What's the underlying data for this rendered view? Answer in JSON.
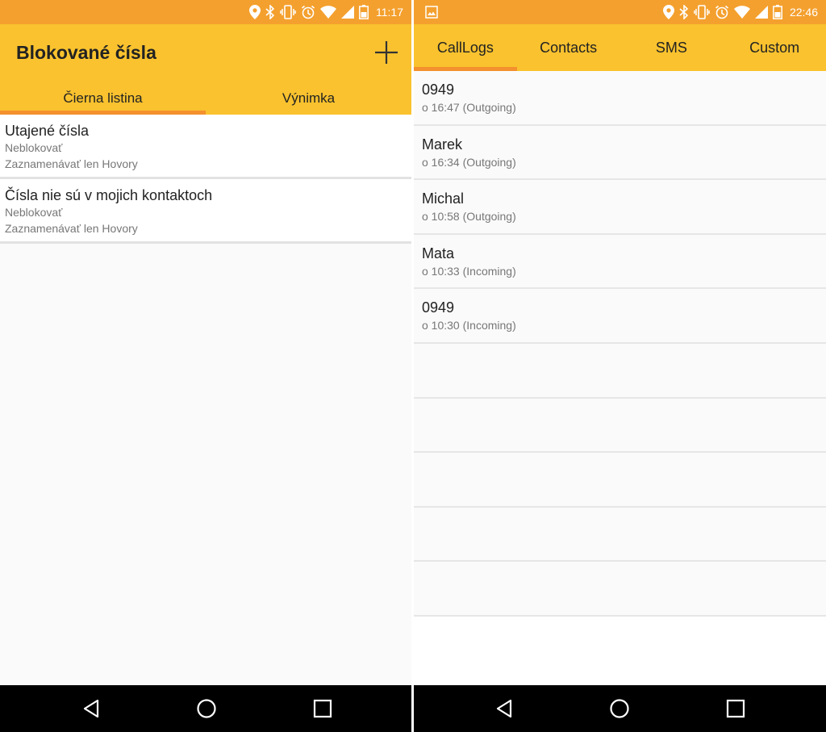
{
  "left": {
    "status": {
      "time": "11:17"
    },
    "appbar": {
      "title": "Blokované čísla"
    },
    "tabs": [
      {
        "label": "Čierna listina",
        "active": true
      },
      {
        "label": "Výnimka",
        "active": false
      }
    ],
    "items": [
      {
        "title": "Utajené čísla",
        "line1": "Neblokovať",
        "line2": "Zaznamenávať len Hovory"
      },
      {
        "title": "Čísla nie sú v mojich kontaktoch",
        "line1": "Neblokovať",
        "line2": "Zaznamenávať len Hovory"
      }
    ]
  },
  "right": {
    "status": {
      "time": "22:46"
    },
    "tabs": [
      {
        "label": "CallLogs",
        "active": true
      },
      {
        "label": "Contacts",
        "active": false
      },
      {
        "label": "SMS",
        "active": false
      },
      {
        "label": "Custom",
        "active": false
      }
    ],
    "calls": [
      {
        "name": "0949",
        "detail": "o 16:47 (Outgoing)"
      },
      {
        "name": "Marek",
        "detail": "o 16:34 (Outgoing)"
      },
      {
        "name": "Michal",
        "detail": "o 10:58 (Outgoing)"
      },
      {
        "name": "Mata",
        "detail": "o 10:33 (Incoming)"
      },
      {
        "name": "0949",
        "detail": "o 10:30 (Incoming)"
      }
    ]
  },
  "icons": {
    "status": [
      "location-icon",
      "bluetooth-icon",
      "vibrate-icon",
      "alarm-icon",
      "wifi-icon",
      "signal-icon",
      "battery-icon"
    ],
    "nav": [
      "back-icon",
      "home-icon",
      "recents-icon"
    ],
    "notification": "image-notification-icon",
    "add": "plus-icon"
  },
  "colors": {
    "statusbar": "#f4a02e",
    "appbar": "#f9c22e",
    "tab_indicator": "#f4902e",
    "navbar": "#000000"
  }
}
